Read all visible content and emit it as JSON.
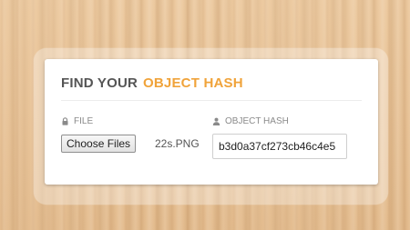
{
  "card": {
    "title_part1": "FIND YOUR",
    "title_part2": "OBJECT HASH"
  },
  "file_section": {
    "label": "FILE",
    "icon": "lock-icon",
    "button_label": "Choose Files",
    "selected_file": "22s.PNG"
  },
  "hash_section": {
    "label": "OBJECT HASH",
    "icon": "user-icon",
    "value": "b3d0a37cf273cb46c4e5"
  },
  "colors": {
    "accent": "#f0a33a",
    "title": "#555555",
    "label": "#8a8a8a",
    "background": "#e9c79c"
  }
}
